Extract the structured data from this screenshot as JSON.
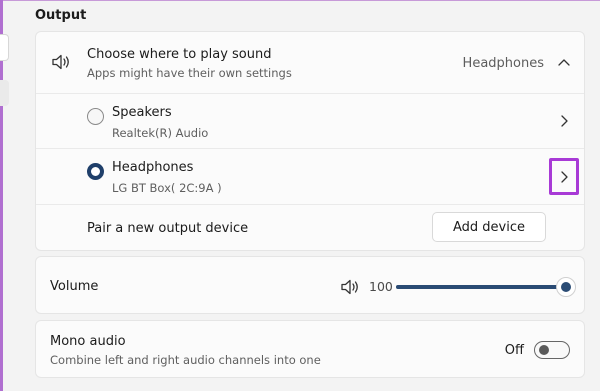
{
  "section": {
    "title": "Output"
  },
  "output": {
    "choose_title": "Choose where to play sound",
    "choose_subtitle": "Apps might have their own settings",
    "current_device": "Headphones",
    "devices": [
      {
        "name": "Speakers",
        "detail": "Realtek(R) Audio",
        "selected": false
      },
      {
        "name": "Headphones",
        "detail": "LG BT Box( 2C:9A )",
        "selected": true
      }
    ],
    "pair_label": "Pair a new output device",
    "add_device_label": "Add device"
  },
  "volume": {
    "label": "Volume",
    "value": "100",
    "level": 1.0
  },
  "mono": {
    "title": "Mono audio",
    "subtitle": "Combine left and right audio channels into one",
    "state_label": "Off",
    "on": false
  },
  "colors": {
    "accent": "#2a4b74",
    "highlight": "#a83ad6",
    "radio_selected": "#1f3f6a"
  }
}
